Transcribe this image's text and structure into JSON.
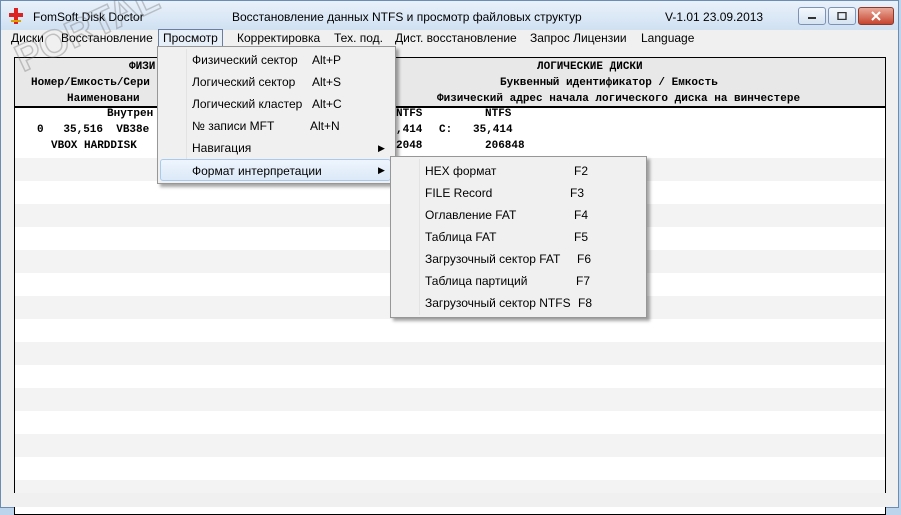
{
  "window": {
    "app_title": "FomSoft Disk Doctor",
    "doc_title": "Восстановление данных NTFS и просмотр файловых структур",
    "version": "V-1.01  23.09.2013",
    "min_label": "▭",
    "max_label": "□",
    "close_label": "✕"
  },
  "menu": {
    "items": [
      "Диски",
      "Восстановление",
      "Просмотр",
      "Корректировка",
      "Тех. под.",
      "Дист. восстановление",
      "Запрос Лицензии",
      "Language"
    ]
  },
  "view_menu": {
    "items": [
      {
        "label": "Физический сектор",
        "key": "Alt+P"
      },
      {
        "label": "Логический сектор",
        "key": "Alt+S"
      },
      {
        "label": "Логический кластер",
        "key": "Alt+C"
      },
      {
        "label": "№ записи MFT",
        "key": "Alt+N"
      },
      {
        "label": "Навигация",
        "key": ""
      },
      {
        "label": "Формат интерпретации",
        "key": ""
      }
    ]
  },
  "format_menu": {
    "items": [
      {
        "label": "HEX формат",
        "key": "F2"
      },
      {
        "label": "FILE Record",
        "key": "F3"
      },
      {
        "label": "Оглавление FAT",
        "key": "F4"
      },
      {
        "label": "Таблица FAT",
        "key": "F5"
      },
      {
        "label": "Загрузочный сектор FAT",
        "key": "F6"
      },
      {
        "label": "Таблица партиций",
        "key": "F7"
      },
      {
        "label": "Загрузочный сектор NTFS",
        "key": "F8"
      }
    ]
  },
  "table": {
    "left_header": [
      "ФИЗИ",
      "Номер/Емкость/Сери",
      "Наименовани"
    ],
    "right_header": [
      "ЛОГИЧЕСКИЕ ДИСКИ",
      "Буквенный идентификатор / Емкость",
      "Физический адрес начала логического диска на винчестере"
    ],
    "subheader_left": "Внутрен",
    "fs_col1": "NTFS",
    "fs_col2": "NTFS",
    "row1_left": "0   35,516  VB38e",
    "row1_cap1": ",414",
    "row1_letter": "C:",
    "row1_cap2": "35,414",
    "row2_left": "VBOX HARDDISK",
    "row2_addr1": "2048",
    "row2_addr2": "206848"
  },
  "watermark": "PORTAL"
}
